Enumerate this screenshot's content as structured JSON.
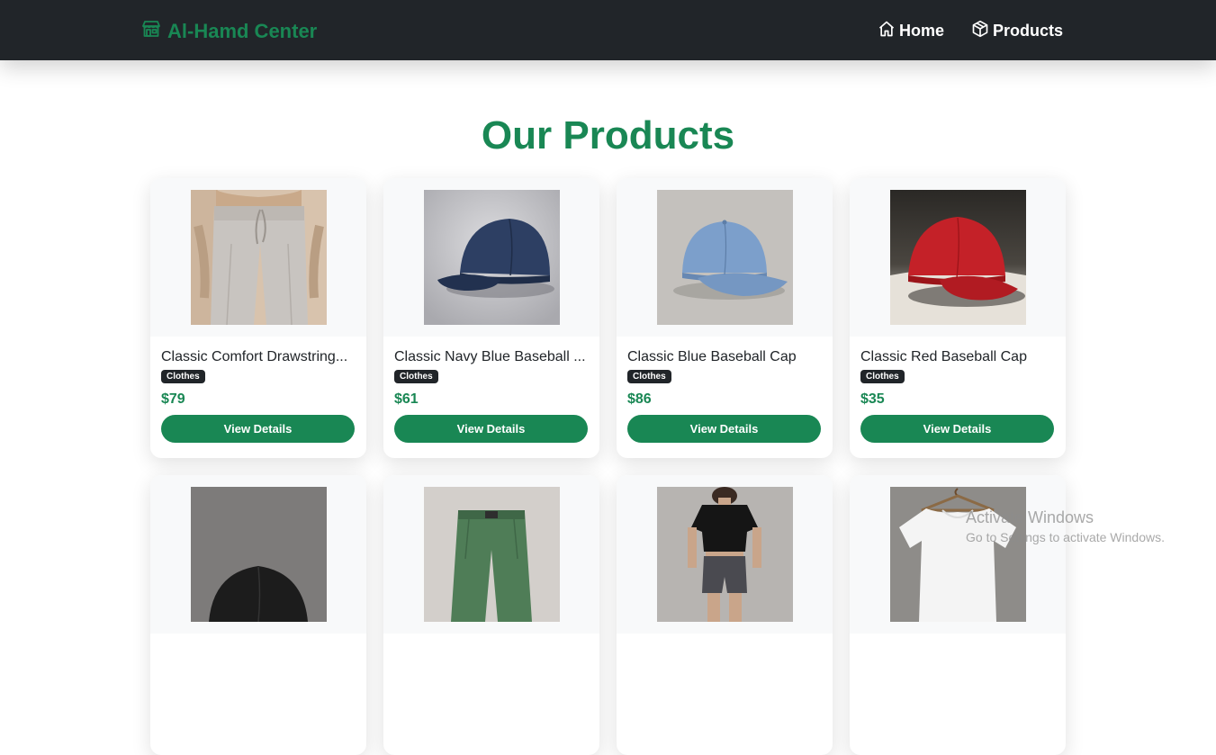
{
  "navbar": {
    "brand": "Al-Hamd Center",
    "links": [
      {
        "label": "Home",
        "icon": "home-icon"
      },
      {
        "label": "Products",
        "icon": "box-icon"
      }
    ]
  },
  "page": {
    "title": "Our Products"
  },
  "products": [
    {
      "title": "Classic Comfort Drawstring...",
      "category": "Clothes",
      "price": "$79",
      "button": "View Details",
      "image": "beige-drawstring-pants"
    },
    {
      "title": "Classic Navy Blue Baseball ...",
      "category": "Clothes",
      "price": "$61",
      "button": "View Details",
      "image": "navy-baseball-cap"
    },
    {
      "title": "Classic Blue Baseball Cap",
      "category": "Clothes",
      "price": "$86",
      "button": "View Details",
      "image": "light-blue-baseball-cap"
    },
    {
      "title": "Classic Red Baseball Cap",
      "category": "Clothes",
      "price": "$35",
      "button": "View Details",
      "image": "red-baseball-cap"
    },
    {
      "title": "",
      "category": "",
      "price": "",
      "button": "",
      "image": "black-baseball-cap"
    },
    {
      "title": "",
      "category": "",
      "price": "",
      "button": "",
      "image": "green-shorts"
    },
    {
      "title": "",
      "category": "",
      "price": "",
      "button": "",
      "image": "black-tshirt-grey-shorts"
    },
    {
      "title": "",
      "category": "",
      "price": "",
      "button": "",
      "image": "white-tshirt-hanger"
    }
  ],
  "watermark": {
    "title": "Activate Windows",
    "subtitle": "Go to Settings to activate Windows."
  },
  "colors": {
    "accent": "#198754",
    "navbar": "#212529"
  }
}
